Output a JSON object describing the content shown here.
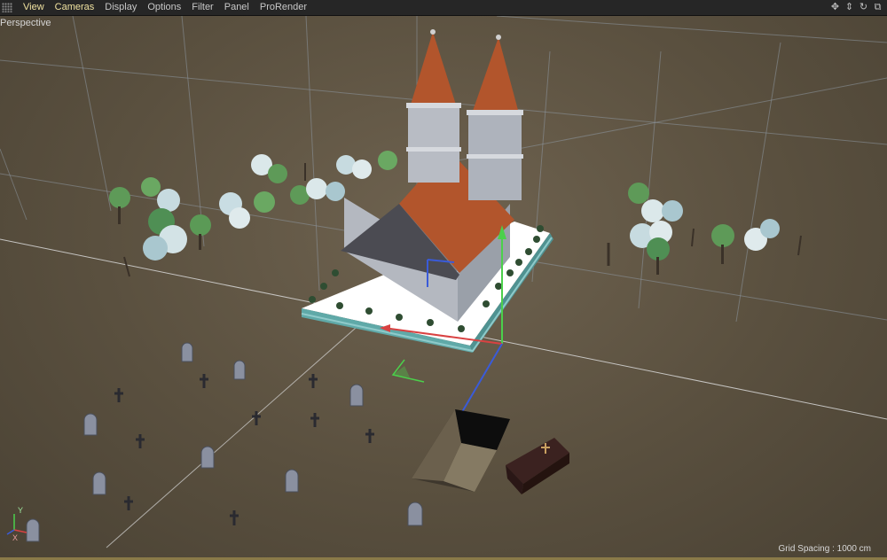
{
  "menu": {
    "items": [
      {
        "label": "View",
        "active": true
      },
      {
        "label": "Cameras",
        "active": true
      },
      {
        "label": "Display",
        "active": false
      },
      {
        "label": "Options",
        "active": false
      },
      {
        "label": "Filter",
        "active": false
      },
      {
        "label": "Panel",
        "active": false
      },
      {
        "label": "ProRender",
        "active": false
      }
    ],
    "nav_icons": [
      "move-view-icon",
      "dolly-icon",
      "rotate-view-icon",
      "maximize-view-icon"
    ]
  },
  "viewport": {
    "camera_label": "Perspective",
    "grid_spacing": "Grid Spacing : 1000 cm"
  },
  "axis": {
    "x": "X",
    "y": "Y"
  },
  "colors": {
    "accent": "#f0e2a0",
    "ground": "#62584a",
    "roof": "#b2552c",
    "wall": "#b4b8c0",
    "fence": "#5fa9a8"
  }
}
